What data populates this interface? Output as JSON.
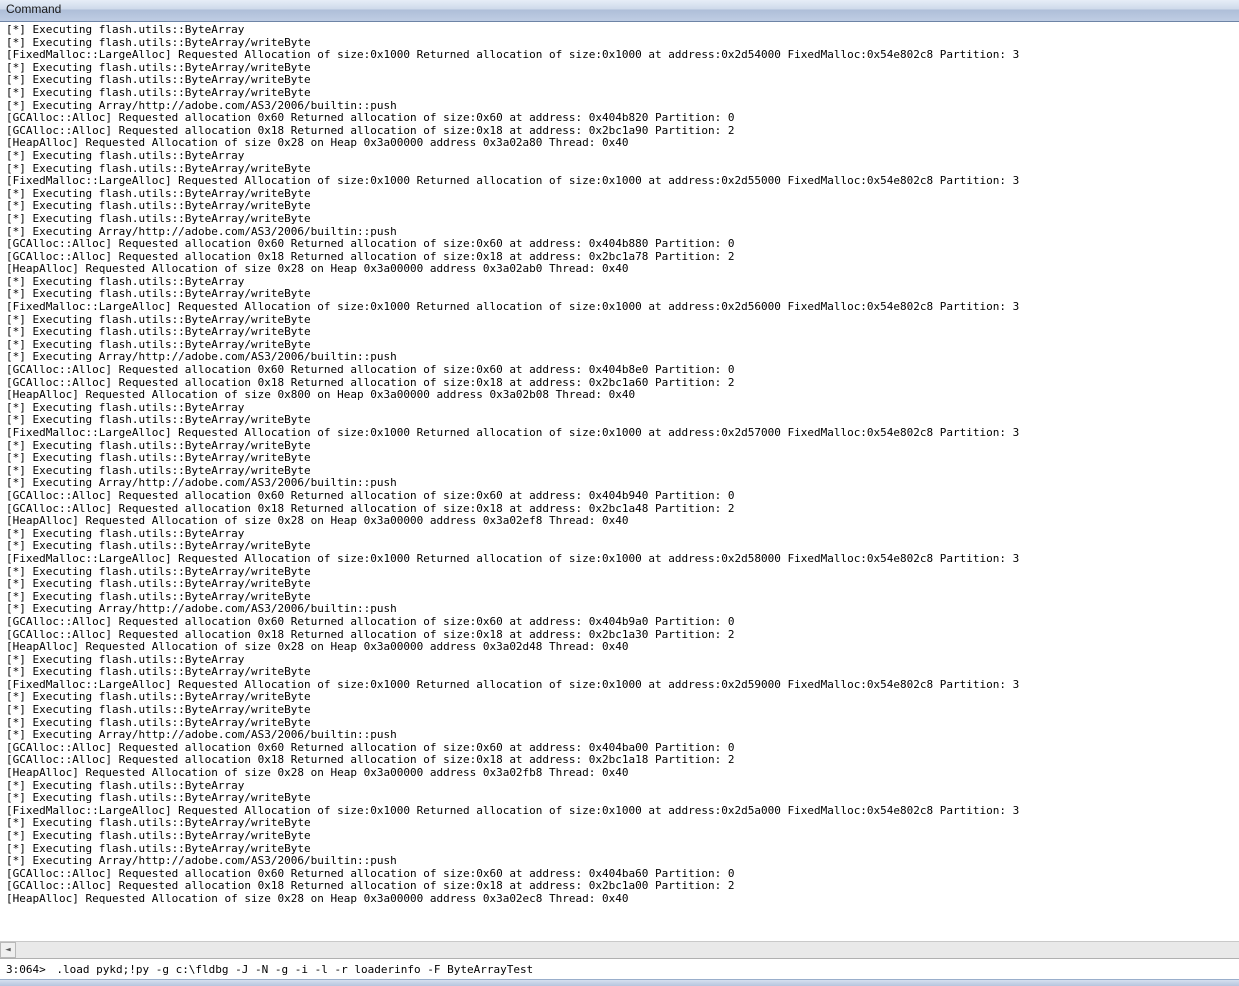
{
  "window": {
    "title": "Command"
  },
  "prompt": "3:064> ",
  "command_input": ".load pykd;!py -g c:\\fldbg -J -N -g -i -l -r loaderinfo -F ByteArrayTest",
  "log_lines": [
    "[*] Executing flash.utils::ByteArray",
    "[*] Executing flash.utils::ByteArray/writeByte",
    "[FixedMalloc::LargeAlloc] Requested Allocation of size:0x1000 Returned allocation of size:0x1000 at address:0x2d54000 FixedMalloc:0x54e802c8 Partition: 3",
    "[*] Executing flash.utils::ByteArray/writeByte",
    "[*] Executing flash.utils::ByteArray/writeByte",
    "[*] Executing flash.utils::ByteArray/writeByte",
    "[*] Executing Array/http://adobe.com/AS3/2006/builtin::push",
    "[GCAlloc::Alloc] Requested allocation 0x60 Returned allocation of size:0x60 at address: 0x404b820 Partition: 0",
    "[GCAlloc::Alloc] Requested allocation 0x18 Returned allocation of size:0x18 at address: 0x2bc1a90 Partition: 2",
    "[HeapAlloc] Requested Allocation of size 0x28 on Heap 0x3a00000 address 0x3a02a80 Thread: 0x40",
    "[*] Executing flash.utils::ByteArray",
    "[*] Executing flash.utils::ByteArray/writeByte",
    "[FixedMalloc::LargeAlloc] Requested Allocation of size:0x1000 Returned allocation of size:0x1000 at address:0x2d55000 FixedMalloc:0x54e802c8 Partition: 3",
    "[*] Executing flash.utils::ByteArray/writeByte",
    "[*] Executing flash.utils::ByteArray/writeByte",
    "[*] Executing flash.utils::ByteArray/writeByte",
    "[*] Executing Array/http://adobe.com/AS3/2006/builtin::push",
    "[GCAlloc::Alloc] Requested allocation 0x60 Returned allocation of size:0x60 at address: 0x404b880 Partition: 0",
    "[GCAlloc::Alloc] Requested allocation 0x18 Returned allocation of size:0x18 at address: 0x2bc1a78 Partition: 2",
    "[HeapAlloc] Requested Allocation of size 0x28 on Heap 0x3a00000 address 0x3a02ab0 Thread: 0x40",
    "[*] Executing flash.utils::ByteArray",
    "[*] Executing flash.utils::ByteArray/writeByte",
    "[FixedMalloc::LargeAlloc] Requested Allocation of size:0x1000 Returned allocation of size:0x1000 at address:0x2d56000 FixedMalloc:0x54e802c8 Partition: 3",
    "[*] Executing flash.utils::ByteArray/writeByte",
    "[*] Executing flash.utils::ByteArray/writeByte",
    "[*] Executing flash.utils::ByteArray/writeByte",
    "[*] Executing Array/http://adobe.com/AS3/2006/builtin::push",
    "[GCAlloc::Alloc] Requested allocation 0x60 Returned allocation of size:0x60 at address: 0x404b8e0 Partition: 0",
    "[GCAlloc::Alloc] Requested allocation 0x18 Returned allocation of size:0x18 at address: 0x2bc1a60 Partition: 2",
    "[HeapAlloc] Requested Allocation of size 0x800 on Heap 0x3a00000 address 0x3a02b08 Thread: 0x40",
    "[*] Executing flash.utils::ByteArray",
    "[*] Executing flash.utils::ByteArray/writeByte",
    "[FixedMalloc::LargeAlloc] Requested Allocation of size:0x1000 Returned allocation of size:0x1000 at address:0x2d57000 FixedMalloc:0x54e802c8 Partition: 3",
    "[*] Executing flash.utils::ByteArray/writeByte",
    "[*] Executing flash.utils::ByteArray/writeByte",
    "[*] Executing flash.utils::ByteArray/writeByte",
    "[*] Executing Array/http://adobe.com/AS3/2006/builtin::push",
    "[GCAlloc::Alloc] Requested allocation 0x60 Returned allocation of size:0x60 at address: 0x404b940 Partition: 0",
    "[GCAlloc::Alloc] Requested allocation 0x18 Returned allocation of size:0x18 at address: 0x2bc1a48 Partition: 2",
    "[HeapAlloc] Requested Allocation of size 0x28 on Heap 0x3a00000 address 0x3a02ef8 Thread: 0x40",
    "[*] Executing flash.utils::ByteArray",
    "[*] Executing flash.utils::ByteArray/writeByte",
    "[FixedMalloc::LargeAlloc] Requested Allocation of size:0x1000 Returned allocation of size:0x1000 at address:0x2d58000 FixedMalloc:0x54e802c8 Partition: 3",
    "[*] Executing flash.utils::ByteArray/writeByte",
    "[*] Executing flash.utils::ByteArray/writeByte",
    "[*] Executing flash.utils::ByteArray/writeByte",
    "[*] Executing Array/http://adobe.com/AS3/2006/builtin::push",
    "[GCAlloc::Alloc] Requested allocation 0x60 Returned allocation of size:0x60 at address: 0x404b9a0 Partition: 0",
    "[GCAlloc::Alloc] Requested allocation 0x18 Returned allocation of size:0x18 at address: 0x2bc1a30 Partition: 2",
    "[HeapAlloc] Requested Allocation of size 0x28 on Heap 0x3a00000 address 0x3a02d48 Thread: 0x40",
    "[*] Executing flash.utils::ByteArray",
    "[*] Executing flash.utils::ByteArray/writeByte",
    "[FixedMalloc::LargeAlloc] Requested Allocation of size:0x1000 Returned allocation of size:0x1000 at address:0x2d59000 FixedMalloc:0x54e802c8 Partition: 3",
    "[*] Executing flash.utils::ByteArray/writeByte",
    "[*] Executing flash.utils::ByteArray/writeByte",
    "[*] Executing flash.utils::ByteArray/writeByte",
    "[*] Executing Array/http://adobe.com/AS3/2006/builtin::push",
    "[GCAlloc::Alloc] Requested allocation 0x60 Returned allocation of size:0x60 at address: 0x404ba00 Partition: 0",
    "[GCAlloc::Alloc] Requested allocation 0x18 Returned allocation of size:0x18 at address: 0x2bc1a18 Partition: 2",
    "[HeapAlloc] Requested Allocation of size 0x28 on Heap 0x3a00000 address 0x3a02fb8 Thread: 0x40",
    "[*] Executing flash.utils::ByteArray",
    "[*] Executing flash.utils::ByteArray/writeByte",
    "[FixedMalloc::LargeAlloc] Requested Allocation of size:0x1000 Returned allocation of size:0x1000 at address:0x2d5a000 FixedMalloc:0x54e802c8 Partition: 3",
    "[*] Executing flash.utils::ByteArray/writeByte",
    "[*] Executing flash.utils::ByteArray/writeByte",
    "[*] Executing flash.utils::ByteArray/writeByte",
    "[*] Executing Array/http://adobe.com/AS3/2006/builtin::push",
    "[GCAlloc::Alloc] Requested allocation 0x60 Returned allocation of size:0x60 at address: 0x404ba60 Partition: 0",
    "[GCAlloc::Alloc] Requested allocation 0x18 Returned allocation of size:0x18 at address: 0x2bc1a00 Partition: 2",
    "[HeapAlloc] Requested Allocation of size 0x28 on Heap 0x3a00000 address 0x3a02ec8 Thread: 0x40"
  ]
}
